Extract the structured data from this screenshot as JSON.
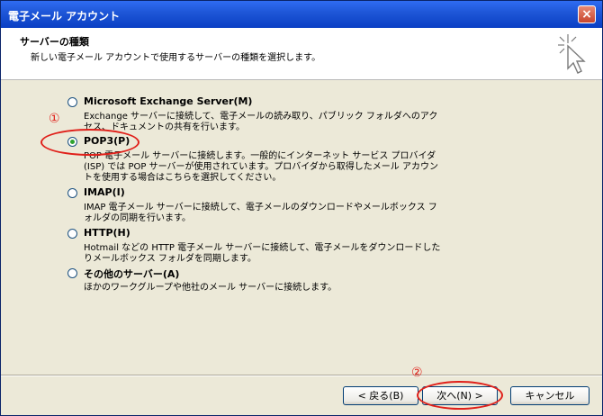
{
  "window": {
    "title": "電子メール アカウント",
    "close_symbol": "×"
  },
  "header": {
    "title": "サーバーの種類",
    "description": "新しい電子メール アカウントで使用するサーバーの種類を選択します。"
  },
  "options": [
    {
      "label": "Microsoft Exchange Server(M)",
      "description": "Exchange サーバーに接続して、電子メールの読み取り、パブリック フォルダへのアクセス、ドキュメントの共有を行います。",
      "selected": false
    },
    {
      "label": "POP3(P)",
      "description": "POP 電子メール サーバーに接続します。一般的にインターネット サービス プロバイダ (ISP) では POP サーバーが使用されています。プロバイダから取得したメール アカウントを使用する場合はこちらを選択してください。",
      "selected": true
    },
    {
      "label": "IMAP(I)",
      "description": "IMAP 電子メール サーバーに接続して、電子メールのダウンロードやメールボックス フォルダの同期を行います。",
      "selected": false
    },
    {
      "label": "HTTP(H)",
      "description": "Hotmail などの HTTP 電子メール サーバーに接続して、電子メールをダウンロードしたりメールボックス フォルダを同期します。",
      "selected": false
    },
    {
      "label": "その他のサーバー(A)",
      "description": "ほかのワークグループや他社のメール サーバーに接続します。",
      "selected": false
    }
  ],
  "buttons": {
    "back": "< 戻る(B)",
    "next": "次へ(N) >",
    "cancel": "キャンセル"
  },
  "annotations": {
    "callout_1": "①",
    "callout_2": "②",
    "color": "#e0201a"
  }
}
